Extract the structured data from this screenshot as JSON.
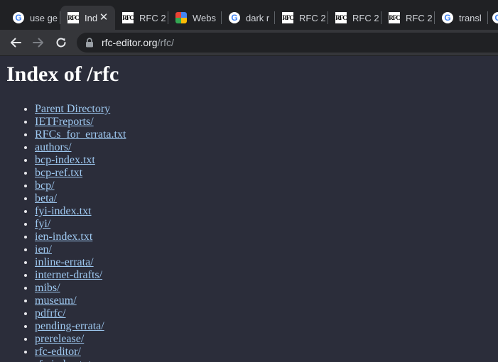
{
  "browser": {
    "tabs": [
      {
        "title": "use ge",
        "icon": "google-icon"
      },
      {
        "title": "Ind",
        "icon": "rfc-icon",
        "active": true
      },
      {
        "title": "RFC 2",
        "icon": "rfc-icon"
      },
      {
        "title": "Webs",
        "icon": "multicolor-grid-icon"
      },
      {
        "title": "dark r",
        "icon": "google-icon"
      },
      {
        "title": "RFC 2",
        "icon": "rfc-icon"
      },
      {
        "title": "RFC 2",
        "icon": "rfc-icon"
      },
      {
        "title": "RFC 2",
        "icon": "rfc-icon"
      },
      {
        "title": "transl",
        "icon": "google-icon"
      }
    ],
    "close_glyph": "✕",
    "favicon_text": {
      "google": "G",
      "rfc": "RFC"
    },
    "address": {
      "host": "rfc-editor.org",
      "path": "/rfc/"
    },
    "colors": {
      "tab_bg": "#202124",
      "toolbar_bg": "#35363a",
      "page_bg": "#2b2d3a",
      "link": "#9ec8f0"
    }
  },
  "page": {
    "title": "Index of /rfc",
    "entries": [
      "Parent Directory",
      "IETFreports/",
      "RFCs_for_errata.txt",
      "authors/",
      "bcp-index.txt",
      "bcp-ref.txt",
      "bcp/",
      "beta/",
      "fyi-index.txt",
      "fyi/",
      "ien-index.txt",
      "ien/",
      "inline-errata/",
      "internet-drafts/",
      "mibs/",
      "museum/",
      "pdfrfc/",
      "pending-errata/",
      "prerelease/",
      "rfc-editor/",
      "rfc-index.txt"
    ]
  }
}
